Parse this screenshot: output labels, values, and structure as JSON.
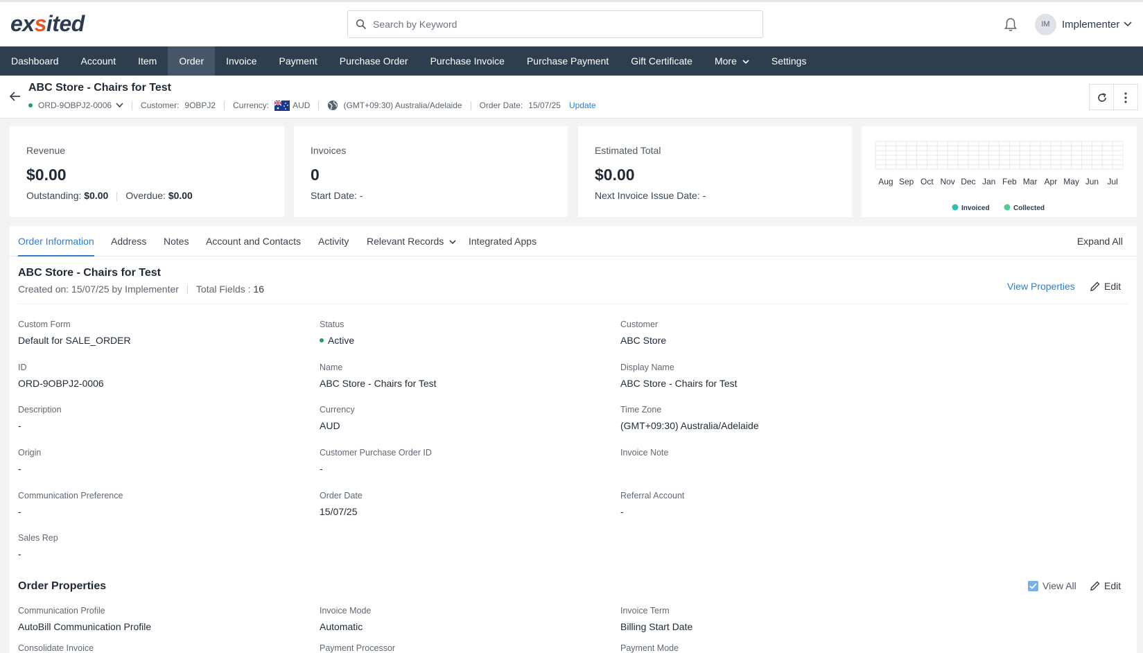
{
  "app": {
    "logo_text_a": "ex",
    "logo_text_b": "ited",
    "logo_accent": "s"
  },
  "search": {
    "placeholder": "Search by Keyword"
  },
  "user": {
    "initials": "IM",
    "name": "Implementer"
  },
  "nav": {
    "items": [
      "Dashboard",
      "Account",
      "Item",
      "Order",
      "Invoice",
      "Payment",
      "Purchase Order",
      "Purchase Invoice",
      "Purchase Payment",
      "Gift Certificate",
      "More",
      "Settings"
    ],
    "active": "Order"
  },
  "header": {
    "title": "ABC Store - Chairs for Test",
    "order_id": "ORD-9OBPJ2-0006",
    "customer_label": "Customer:",
    "customer_value": "9OBPJ2",
    "currency_label": "Currency:",
    "currency_value": "AUD",
    "timezone": "(GMT+09:30) Australia/Adelaide",
    "order_date_label": "Order Date:",
    "order_date_value": "15/07/25",
    "update_link": "Update"
  },
  "cards": {
    "revenue": {
      "label": "Revenue",
      "value": "$0.00",
      "outstanding_label": "Outstanding:",
      "outstanding_value": "$0.00",
      "overdue_label": "Overdue:",
      "overdue_value": "$0.00"
    },
    "invoices": {
      "label": "Invoices",
      "value": "0",
      "start_label": "Start Date:",
      "start_value": "-"
    },
    "estimated": {
      "label": "Estimated Total",
      "value": "$0.00",
      "next_label": "Next Invoice Issue Date:",
      "next_value": "-"
    }
  },
  "chart_data": {
    "type": "bar",
    "categories": [
      "Aug",
      "Sep",
      "Oct",
      "Nov",
      "Dec",
      "Jan",
      "Feb",
      "Mar",
      "Apr",
      "May",
      "Jun",
      "Jul"
    ],
    "series": [
      {
        "name": "Invoiced",
        "values": [
          0,
          0,
          0,
          0,
          0,
          0,
          0,
          0,
          0,
          0,
          0,
          0
        ],
        "color": "#2bbfb6"
      },
      {
        "name": "Collected",
        "values": [
          0,
          0,
          0,
          0,
          0,
          0,
          0,
          0,
          0,
          0,
          0,
          0
        ],
        "color": "#4ccf95"
      }
    ],
    "legend": "bottom",
    "grid": true
  },
  "tabs": {
    "items": [
      "Order Information",
      "Address",
      "Notes",
      "Account and Contacts",
      "Activity",
      "Relevant Records",
      "Integrated Apps"
    ],
    "active": "Order Information",
    "expand_all": "Expand All"
  },
  "details": {
    "title": "ABC Store - Chairs for Test",
    "created": "Created on: 15/07/25 by Implementer",
    "total_fields_label": "Total Fields :",
    "total_fields_value": "16",
    "view_properties": "View Properties",
    "edit_label": "Edit",
    "fields": {
      "custom_form": {
        "label": "Custom Form",
        "value": "Default for SALE_ORDER"
      },
      "status": {
        "label": "Status",
        "value": "Active"
      },
      "customer": {
        "label": "Customer",
        "value": "ABC Store"
      },
      "id": {
        "label": "ID",
        "value": "ORD-9OBPJ2-0006"
      },
      "name": {
        "label": "Name",
        "value": "ABC Store - Chairs for Test"
      },
      "display_name": {
        "label": "Display Name",
        "value": "ABC Store - Chairs for Test"
      },
      "description": {
        "label": "Description",
        "value": "-"
      },
      "currency": {
        "label": "Currency",
        "value": "AUD"
      },
      "time_zone": {
        "label": "Time Zone",
        "value": "(GMT+09:30) Australia/Adelaide"
      },
      "origin": {
        "label": "Origin",
        "value": "-"
      },
      "customer_po": {
        "label": "Customer Purchase Order ID",
        "value": "-"
      },
      "invoice_note": {
        "label": "Invoice Note",
        "value": ""
      },
      "comm_pref": {
        "label": "Communication Preference",
        "value": "-"
      },
      "order_date": {
        "label": "Order Date",
        "value": "15/07/25"
      },
      "referral": {
        "label": "Referral Account",
        "value": "-"
      },
      "sales_rep": {
        "label": "Sales Rep",
        "value": "-"
      }
    }
  },
  "properties": {
    "title": "Order Properties",
    "view_all": "View All",
    "edit_label": "Edit",
    "fields": {
      "comm_profile": {
        "label": "Communication Profile",
        "value": "AutoBill Communication Profile"
      },
      "invoice_mode": {
        "label": "Invoice Mode",
        "value": "Automatic"
      },
      "invoice_term": {
        "label": "Invoice Term",
        "value": "Billing Start Date"
      },
      "consolidate": {
        "label": "Consolidate Invoice"
      },
      "processor": {
        "label": "Payment Processor"
      },
      "pay_mode": {
        "label": "Payment Mode"
      }
    }
  },
  "colors": {
    "nav_bg": "#2f3e4f",
    "nav_active": "#465567",
    "accent": "#2d7dd2",
    "status_active": "#1e9e6a"
  }
}
